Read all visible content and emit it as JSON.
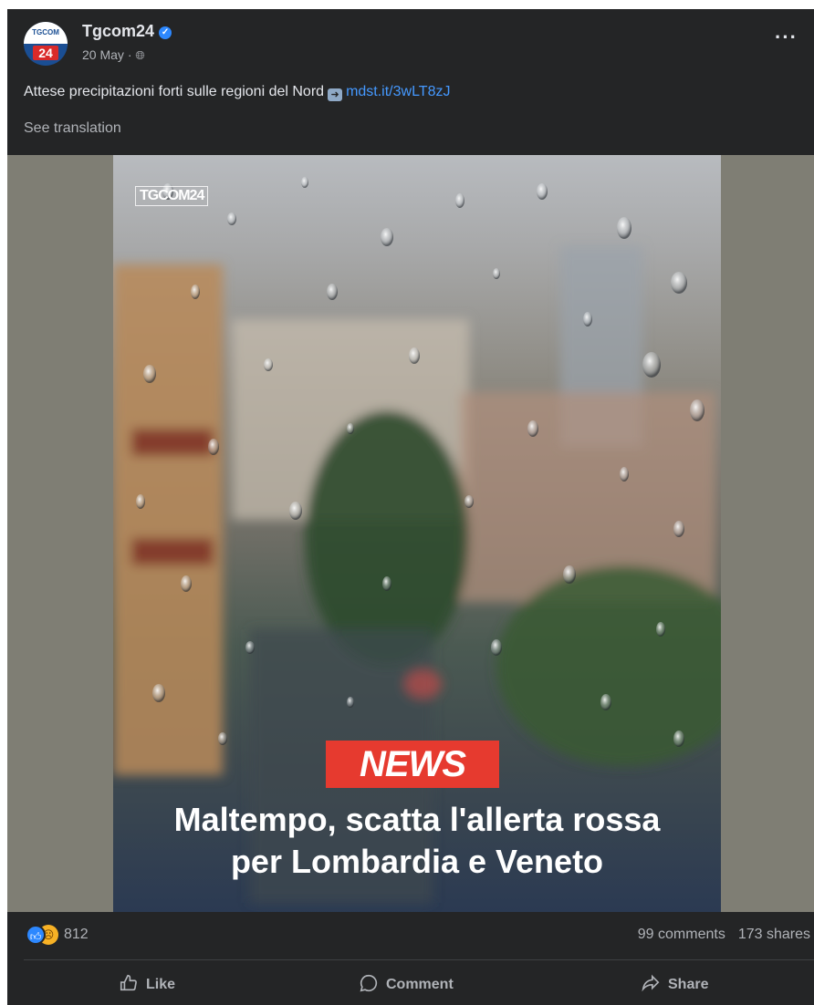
{
  "post": {
    "author": "Tgcom24",
    "avatar": {
      "top_text": "TGCOM",
      "bottom_text": "24"
    },
    "date": "20 May",
    "separator": "·",
    "caption_text": "Attese precipitazioni forti sulle regioni del Nord",
    "caption_link": "mdst.it/3wLT8zJ",
    "see_translation": "See translation"
  },
  "image": {
    "watermark": "TGCOM24",
    "badge": "NEWS",
    "headline_line1": "Maltempo, scatta l'allerta rossa",
    "headline_line2": "per Lombardia e Veneto"
  },
  "stats": {
    "reaction_count": "812",
    "comments": "99 comments",
    "shares": "173 shares"
  },
  "actions": {
    "like": "Like",
    "comment": "Comment",
    "share": "Share"
  },
  "icons": {
    "verified": "verified-badge-icon",
    "privacy": "globe-icon",
    "more": "more-options-icon",
    "link_arrow": "arrow-right-icon"
  },
  "colors": {
    "background": "#242526",
    "link": "#4599ff",
    "news_badge": "#e63a2f",
    "like_reaction": "#2d88ff",
    "sad_reaction": "#f7b125"
  }
}
